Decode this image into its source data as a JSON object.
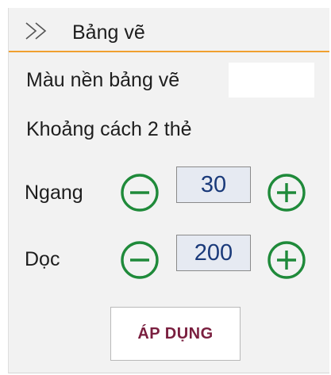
{
  "panel": {
    "title": "Bảng vẽ",
    "icon": "double-chevron-right-icon"
  },
  "background_color": {
    "label": "Màu nền bảng vẽ",
    "value": "#ffffff"
  },
  "spacing": {
    "label": "Khoảng cách 2 thẻ",
    "horizontal": {
      "label": "Ngang",
      "value": "30"
    },
    "vertical": {
      "label": "Dọc",
      "value": "200"
    }
  },
  "apply_button": {
    "label": "ÁP DỤNG"
  },
  "colors": {
    "accent": "#f0a030",
    "stepper": "#1f8a3a",
    "value_text": "#1a3a7a",
    "apply_text": "#7a1f3f"
  }
}
